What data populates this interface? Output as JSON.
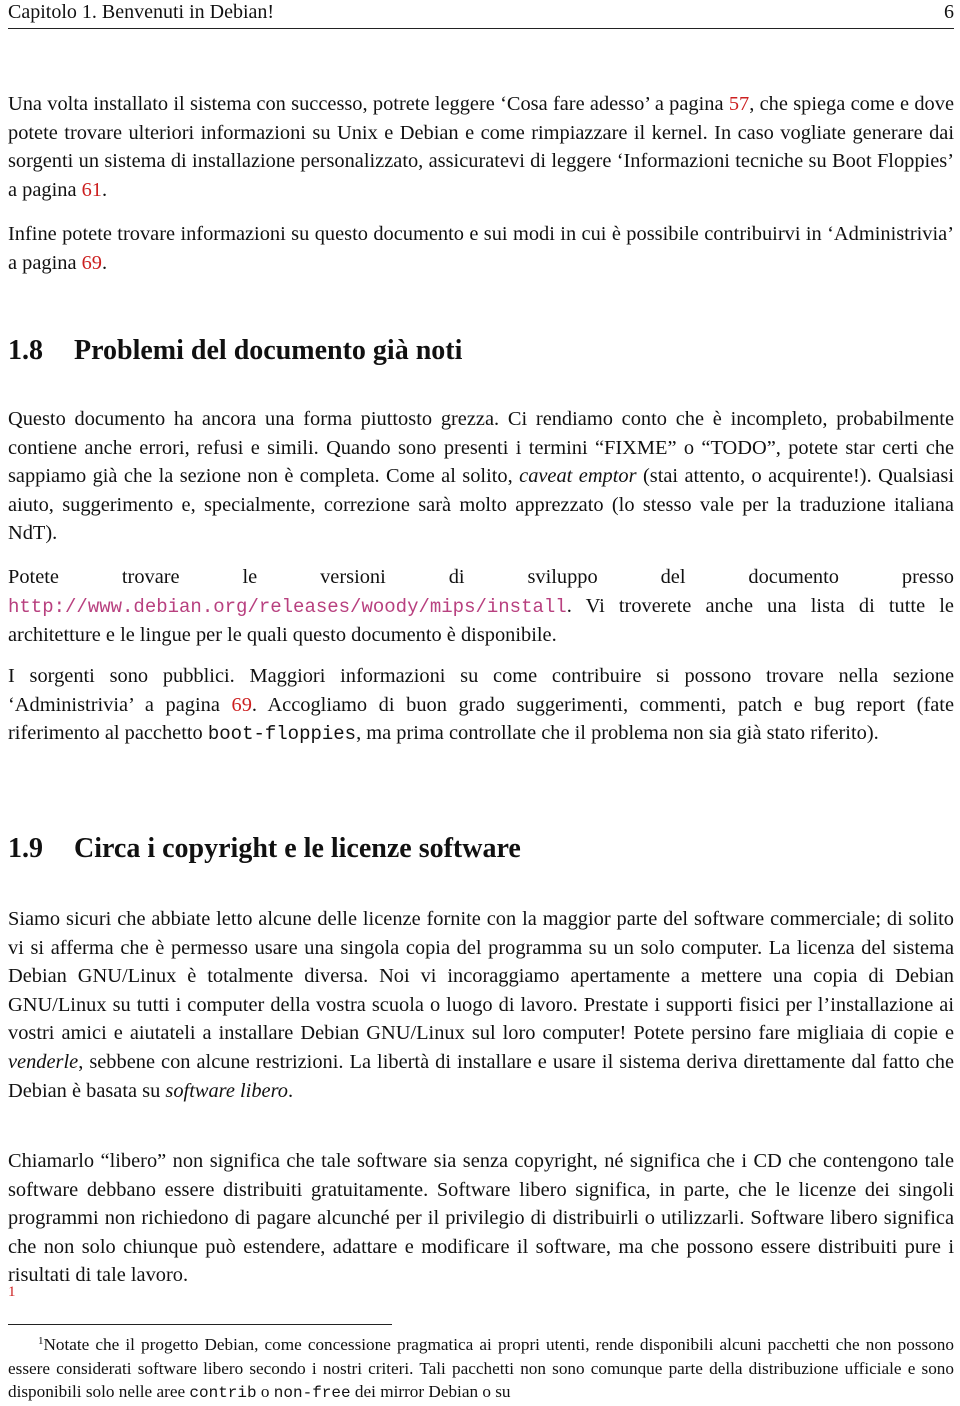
{
  "header": {
    "chapter": "Capitolo 1. Benvenuti in Debian!",
    "page_number": "6"
  },
  "colors": {
    "link": "#cc1f1f",
    "url": "#b8407f",
    "text": "#111111"
  },
  "p1": {
    "a": "Una volta installato il sistema con successo, potrete leggere ‘Cosa fare adesso’ a pagina ",
    "link1": "57",
    "b": ", che spiega come e dove potete trovare ulteriori informazioni su Unix e Debian e come rimpiazzare il kernel.  In caso vogliate generare dai sorgenti un sistema di installazione personalizzato, assicuratevi di leggere ‘Informazioni tecniche su Boot Floppies’ a pagina ",
    "link2": "61",
    "c": "."
  },
  "p2": {
    "a": "Infine potete trovare informazioni su questo documento e sui modi in cui è possibile contribuirvi in ‘Administrivia’ a pagina ",
    "link": "69",
    "b": "."
  },
  "section_18": {
    "number": "1.8",
    "title": "Problemi del documento già noti"
  },
  "p3": {
    "a": "Questo documento ha ancora una forma piuttosto grezza. Ci rendiamo conto che è incompleto, probabilmente contiene anche errori, refusi e simili. Quando sono presenti i termini “FIXME” o “TODO”, potete star certi che sappiamo già che la sezione non è completa.  Come al solito, ",
    "em": "caveat emptor",
    "b": " (stai attento, o acquirente!).  Qualsiasi aiuto, suggerimento e, specialmente, correzione sarà molto apprezzato (lo stesso vale per la traduzione italiana NdT)."
  },
  "p4": {
    "a": "Potete trovare le versioni di sviluppo del documento presso ",
    "url": "http://www.debian.org/releases/woody/mips/install",
    "b": ".  Vi troverete anche una lista di tutte le architetture e le lingue per le quali questo documento è disponibile."
  },
  "p5": {
    "a": "I sorgenti sono pubblici.  Maggiori informazioni su come contribuire si possono trovare nella sezione ‘Administrivia’ a pagina ",
    "link": "69",
    "b": ".  Accogliamo di buon grado suggerimenti, commenti, patch e bug report (fate riferimento al pacchetto ",
    "code": "boot-floppies",
    "c": ", ma prima controllate che il problema non sia già stato riferito)."
  },
  "section_19": {
    "number": "1.9",
    "title": "Circa i copyright e le licenze software"
  },
  "p6": {
    "a": "Siamo sicuri che abbiate letto alcune delle licenze fornite con la maggior parte del software commerciale; di solito vi si afferma che è permesso usare una singola copia del programma su un solo computer.  La licenza del sistema Debian GNU/Linux è totalmente diversa.  Noi vi incoraggiamo apertamente a mettere una copia di Debian GNU/Linux su tutti i computer della vostra scuola o luogo di lavoro. Prestate i supporti fisici per l’installazione ai vostri amici e aiutateli a installare Debian GNU/Linux sul loro computer!  Potete persino fare migliaia di copie e ",
    "em1": "venderle",
    "b": ", sebbene con alcune restrizioni. La libertà di installare e usare il sistema deriva direttamente dal fatto che Debian è basata su ",
    "em2": "software libero",
    "c": "."
  },
  "p7": {
    "text": "Chiamarlo “libero” non significa che tale software sia senza copyright, né significa che i CD che contengono tale software debbano essere distribuiti gratuitamente. Software libero significa, in parte, che le licenze dei singoli programmi non richiedono di pagare alcunché per il privilegio di distribuirli o utilizzarli.  Software libero significa che non solo chiunque può estendere, adattare e modificare il software, ma che possono essere distribuiti pure i risultati di tale lavoro.",
    "footnote_ref": "1"
  },
  "footnote": {
    "marker": "1",
    "a": "Notate che il progetto Debian, come concessione pragmatica ai propri utenti, rende disponibili alcuni pacchetti che non possono essere considerati software libero secondo i nostri criteri.  Tali pacchetti non sono comunque parte della distribuzione ufficiale e sono disponibili solo nelle aree ",
    "code1": "contrib",
    "b": " o ",
    "code2": "non-free",
    "c": " dei mirror Debian o su"
  }
}
